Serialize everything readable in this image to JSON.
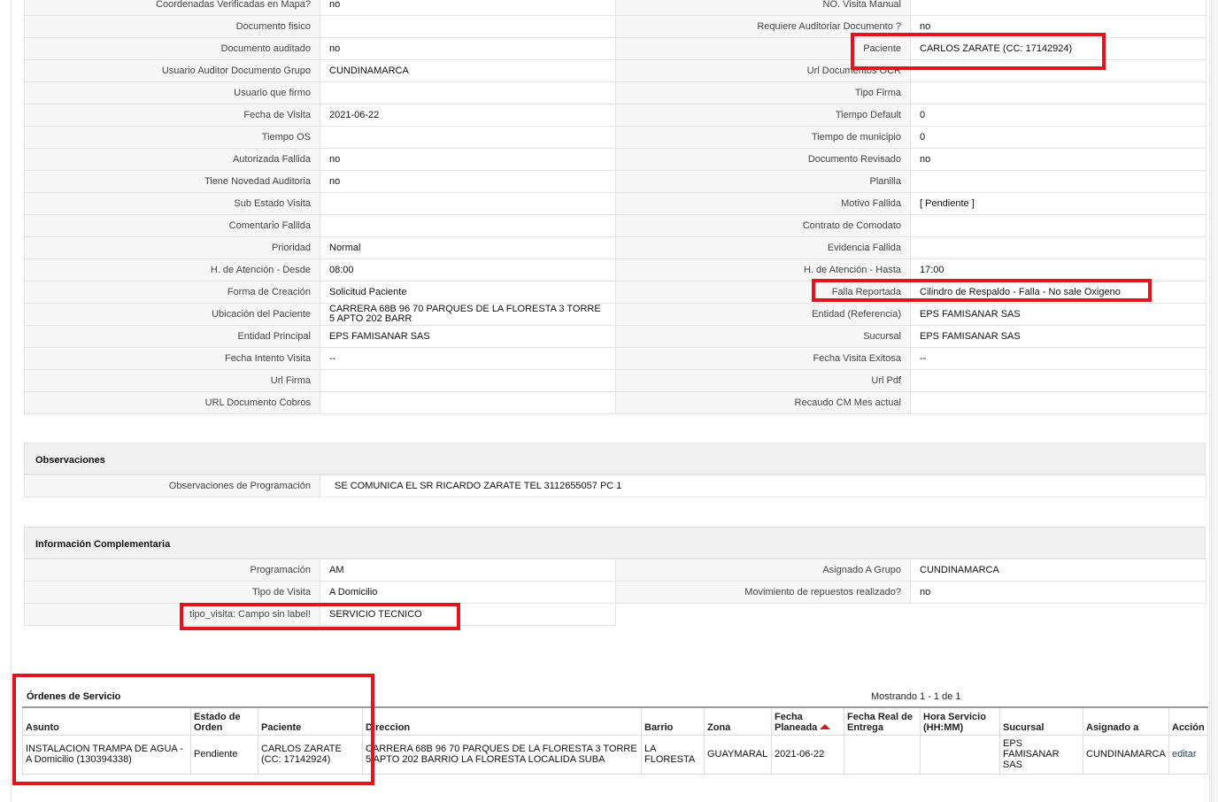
{
  "detail_rows": [
    {
      "l1": "Coordenadas Verificadas en Mapa?",
      "v1": "no",
      "l2": "NO. Visita Manual",
      "v2": ""
    },
    {
      "l1": "Documento fisico",
      "v1": "",
      "l2": "Requiere Auditoriar Documento ?",
      "v2": "no"
    },
    {
      "l1": "Documento auditado",
      "v1": "no",
      "l2": "Paciente",
      "v2": "CARLOS ZARATE (CC: 17142924)"
    },
    {
      "l1": "Usuario Auditor Documento Grupo",
      "v1": "CUNDINAMARCA",
      "l2": "Url Documentos OCR",
      "v2": ""
    },
    {
      "l1": "Usuario que firmo",
      "v1": "",
      "l2": "Tipo Firma",
      "v2": ""
    },
    {
      "l1": "Fecha de Visita",
      "v1": "2021-06-22",
      "l2": "Tiempo Default",
      "v2": "0"
    },
    {
      "l1": "Tiempo OS",
      "v1": "",
      "l2": "Tiempo de municipio",
      "v2": "0"
    },
    {
      "l1": "Autorizada Fallida",
      "v1": "no",
      "l2": "Documento Revisado",
      "v2": "no"
    },
    {
      "l1": "Tiene Novedad Auditoria",
      "v1": "no",
      "l2": "Planilla",
      "v2": ""
    },
    {
      "l1": "Sub Estado Visita",
      "v1": "",
      "l2": "Motivo Fallida",
      "v2": "[ Pendiente ]"
    },
    {
      "l1": "Comentario Fallida",
      "v1": "",
      "l2": "Contrato de Comodato",
      "v2": ""
    },
    {
      "l1": "Prioridad",
      "v1": "Normal",
      "l2": "Evidencia Fallida",
      "v2": ""
    },
    {
      "l1": "H. de Atención - Desde",
      "v1": "08:00",
      "l2": "H. de Atención - Hasta",
      "v2": "17:00"
    },
    {
      "l1": "Forma de Creación",
      "v1": "Solicitud Paciente",
      "l2": "Falla Reportada",
      "v2": "Cilindro de Respaldo - Falla - No sale Oxigeno"
    },
    {
      "l1": "Ubicación del Paciente",
      "v1": "CARRERA 68B 96 70 PARQUES DE LA FLORESTA 3 TORRE 5 APTO 202 BARR",
      "l2": "Entidad (Referencia)",
      "v2": "EPS FAMISANAR SAS"
    },
    {
      "l1": "Entidad Principal",
      "v1": "EPS FAMISANAR SAS",
      "l2": "Sucursal",
      "v2": "EPS FAMISANAR SAS"
    },
    {
      "l1": "Fecha Intento Visita",
      "v1": "--",
      "l2": "Fecha Visita Exitosa",
      "v2": "--"
    },
    {
      "l1": "Url Firma",
      "v1": "",
      "l2": "Url Pdf",
      "v2": ""
    },
    {
      "l1": "URL Documento Cobros",
      "v1": "",
      "l2": "Recaudo CM Mes actual",
      "v2": ""
    }
  ],
  "observaciones": {
    "title": "Observaciones",
    "label": "Observaciones de Programación",
    "value": "SE COMUNICA EL SR RICARDO ZARATE TEL 3112655057 PC 1"
  },
  "info": {
    "title": "Información Complementaria",
    "rows": [
      {
        "l1": "Programación",
        "v1": "AM",
        "l2": "Asignado A Grupo",
        "v2": "CUNDINAMARCA"
      },
      {
        "l1": "Tipo de Visita",
        "v1": "A Domicilio",
        "l2": "Movimiento de repuestos realizado?",
        "v2": "no"
      },
      {
        "l1": "tipo_visita: Campo sin label!",
        "v1": "SERVICIO TECNICO",
        "l2": "",
        "v2": ""
      }
    ]
  },
  "orders": {
    "title": "Órdenes de Servicio",
    "count_text": "Mostrando 1 - 1 de 1",
    "headers": [
      "Asunto",
      "Estado de Orden",
      "Paciente",
      "Direccion",
      "Barrio",
      "Zona",
      "Fecha Planeada",
      "Fecha Real de Entrega",
      "Hora Servicio (HH:MM)",
      "Sucursal",
      "Asignado a",
      "Acción"
    ],
    "rows": [
      [
        "INSTALACION TRAMPA DE AGUA - A Domicilio (130394338)",
        "Pendiente",
        "CARLOS ZARATE (CC: 17142924)",
        "CARRERA 68B 96 70 PARQUES DE LA FLORESTA 3 TORRE 5 APTO 202 BARRIO LA FLORESTA LOCALIDA SUBA",
        "LA FLORESTA",
        "GUAYMARAL",
        "2021-06-22",
        "",
        "",
        "EPS FAMISANAR SAS",
        "CUNDINAMARCA",
        "editar"
      ]
    ],
    "sort_icon": "sort-asc-icon"
  },
  "colors": {
    "highlight": "#e2151f",
    "sort_arrow": "#cc1d1d",
    "label_bg": "#f7f7f7",
    "section_bg": "#f1f1f1"
  }
}
